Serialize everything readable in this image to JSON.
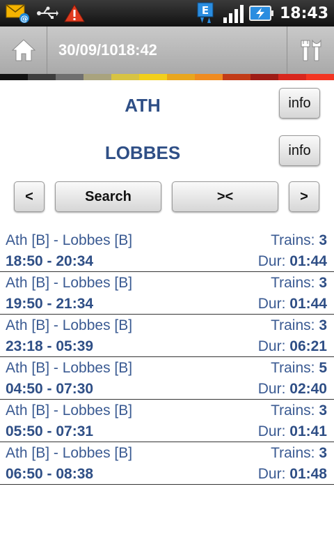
{
  "status_bar": {
    "time": "18:43",
    "icons": [
      "email-notification-icon",
      "usb-icon",
      "warning-icon",
      "edge-data-icon",
      "signal-icon",
      "battery-charging-icon"
    ],
    "edge_label": "E"
  },
  "header": {
    "date": "30/09/10",
    "time": "18:42",
    "home_icon": "home-icon",
    "tools_icon": "tools-icon"
  },
  "stripe_colors": [
    "#111111",
    "#3d3d3d",
    "#6f6f6f",
    "#a9a37e",
    "#d7c343",
    "#f2cf1b",
    "#e9a61d",
    "#ef8b20",
    "#c23b17",
    "#9e1c16",
    "#d8261d",
    "#f23522"
  ],
  "stations": {
    "from": "ATH",
    "to": "LOBBES",
    "info_label": "info"
  },
  "nav": {
    "prev_label": "<",
    "search_label": "Search",
    "swap_label": "><",
    "next_label": ">"
  },
  "results": {
    "trains_label": "Trains:",
    "dur_label": "Dur:",
    "items": [
      {
        "route": "Ath [B] - Lobbes [B]",
        "trains": "3",
        "times": "18:50 - 20:34",
        "duration": "01:44"
      },
      {
        "route": "Ath [B] - Lobbes [B]",
        "trains": "3",
        "times": "19:50 - 21:34",
        "duration": "01:44"
      },
      {
        "route": "Ath [B] - Lobbes [B]",
        "trains": "3",
        "times": "23:18 - 05:39",
        "duration": "06:21"
      },
      {
        "route": "Ath [B] - Lobbes [B]",
        "trains": "5",
        "times": "04:50 - 07:30",
        "duration": "02:40"
      },
      {
        "route": "Ath [B] - Lobbes [B]",
        "trains": "3",
        "times": "05:50 - 07:31",
        "duration": "01:41"
      },
      {
        "route": "Ath [B] - Lobbes [B]",
        "trains": "3",
        "times": "06:50 - 08:38",
        "duration": "01:48"
      }
    ]
  }
}
